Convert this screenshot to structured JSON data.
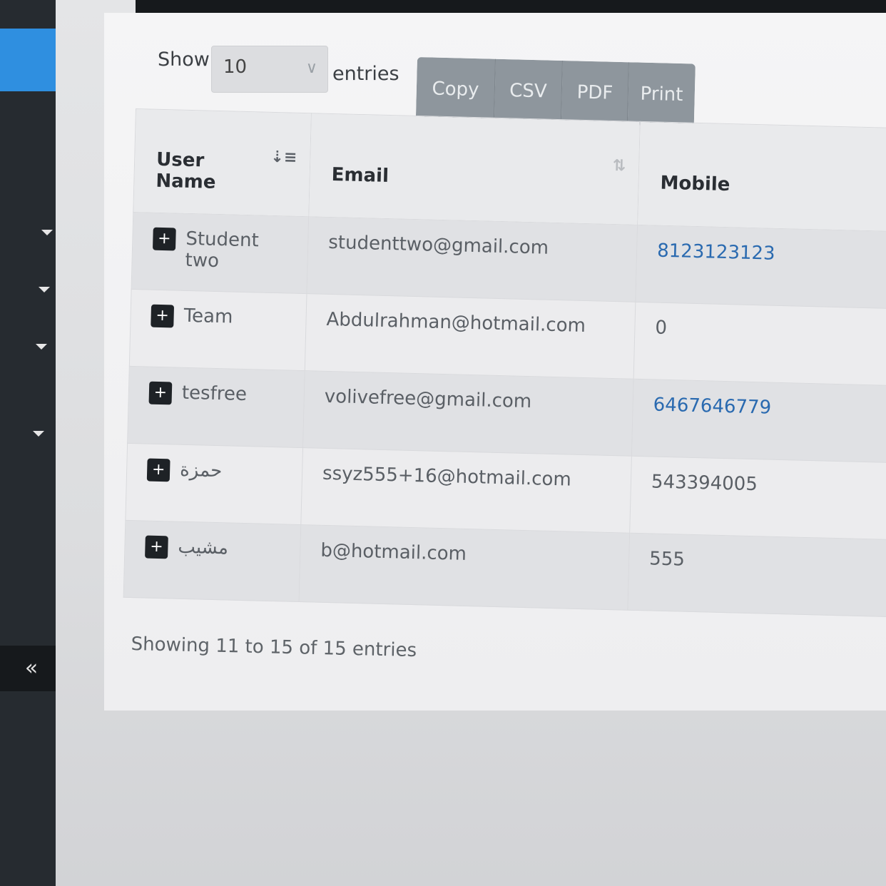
{
  "sidebar": {
    "collapse_icon": "«"
  },
  "controls": {
    "show_label": "Show",
    "page_length": "10",
    "entries_label": "entries",
    "buttons": [
      "Copy",
      "CSV",
      "PDF",
      "Print"
    ]
  },
  "table": {
    "headers": [
      "User Name",
      "Email",
      "Mobile"
    ],
    "rows": [
      {
        "user": "Student two",
        "email": "studenttwo@gmail.com",
        "mobile": "8123123123"
      },
      {
        "user": "Team",
        "email": "Abdulrahman@hotmail.com",
        "mobile": "0"
      },
      {
        "user": "tesfree",
        "email": "volivefree@gmail.com",
        "mobile": "6467646779"
      },
      {
        "user": "حمزة",
        "email": "ssyz555+16@hotmail.com",
        "mobile": "543394005"
      },
      {
        "user": "مشيب",
        "email": "b@hotmail.com",
        "mobile": "555"
      }
    ]
  },
  "footer": {
    "showing": "Showing 11 to 15 of 15 entries"
  },
  "colors": {
    "sidebar_active": "#2f8fe0",
    "link": "#2a6ab0",
    "button": "#8e969d"
  }
}
